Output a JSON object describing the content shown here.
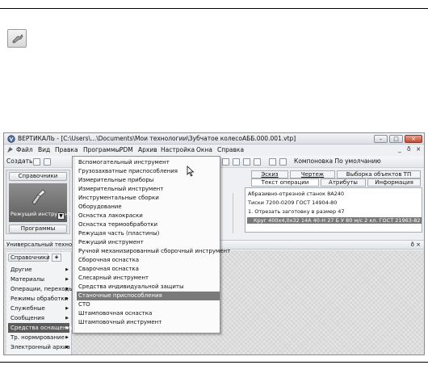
{
  "window": {
    "title": "ВЕРТИКАЛЬ - [C:\\Users\\...\\Documents\\Мои технологии\\Зубчатое колесоАББ.000.001.vtp]",
    "controls": [
      "–",
      "□",
      "×"
    ]
  },
  "menubar": {
    "items": [
      "Файл",
      "Вид",
      "Правка",
      "Программы",
      "PDM",
      "Архив",
      "Настройка",
      "Окна",
      "Справка"
    ],
    "doc_controls": [
      "_",
      "ð",
      "×"
    ]
  },
  "toolbar": {
    "create_label": "Создать",
    "layout_label": "Компоновка  По умолчанию"
  },
  "left_panel": {
    "header": "Справочники",
    "tool_label": "Режущий инструмент",
    "programs_label": "Программы"
  },
  "right_panel": {
    "tabs_row1": [
      "Эскиз",
      "Чертеж",
      "Выборка объектов ТП"
    ],
    "tabs_row2": [
      "Текст операции",
      "Атрибуты",
      "Информация"
    ],
    "lines": [
      "Абразивно-отрезной станок 8А240",
      "Тиски 7200-0209  ГОСТ 14904-80",
      "1.  Отрезать заготовку в размер 47",
      "Круг 400х4,0х32 14А 40-Н 27 Б У 80 м/с 2 кл.  ГОСТ 21963-82"
    ],
    "selected_line_index": 3
  },
  "universal_bar": {
    "title": "Универсальный технолог",
    "close": "ð ×"
  },
  "nav": {
    "header": "Справочники ▾",
    "items": [
      "Другие",
      "Материалы",
      "Операции, переходы",
      "Режимы обработки",
      "Служебные",
      "Сообщения",
      "Средства оснащения",
      "Тр. нормирование",
      "Электронный архив"
    ],
    "selected_index": 6
  },
  "submenu": {
    "items": [
      "Вспомогательный инструмент",
      "Грузозахватные приспособления",
      "Измерительные приборы",
      "Измерительный инструмент",
      "Инструментальные сборки",
      "Оборудование",
      "Оснастка лакокраски",
      "Оснастка термообработки",
      "Режущая часть (пластины)",
      "Режущий инструмент",
      "Ручной механизированный сборочный инструмент",
      "Сборочная оснастка",
      "Сварочная оснастка",
      "Слесарный инструмент",
      "Средства индивидуальной защиты",
      "Станочные приспособления",
      "СТО",
      "Штамповочная оснастка",
      "Штамповочный инструмент"
    ],
    "selected_index": 15
  },
  "colors": {
    "selection": "#7a7a7a",
    "close_button": "#c24b32"
  }
}
